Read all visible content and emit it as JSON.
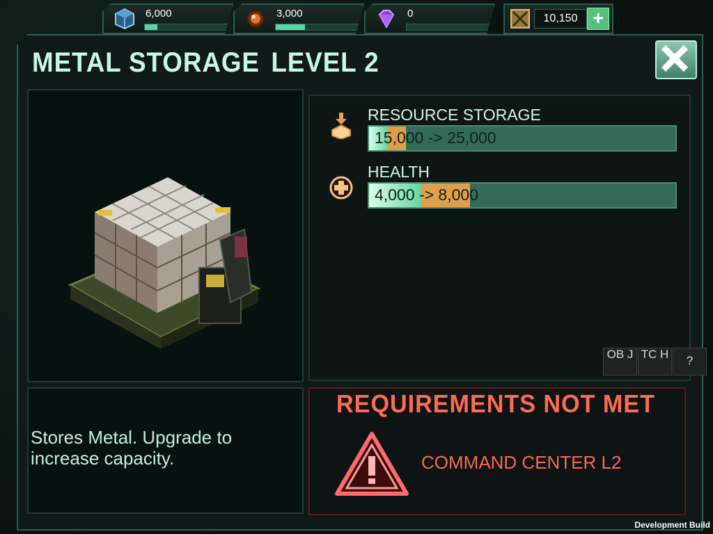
{
  "resources": {
    "metal": {
      "value": "6,000",
      "fill": 0.15
    },
    "oil": {
      "value": "3,000",
      "fill": 0.35
    },
    "gems": {
      "value": "0",
      "fill": 0.0
    },
    "gold": {
      "value": "10,150"
    }
  },
  "panel": {
    "title": "METAL STORAGE",
    "level": "LEVEL 2",
    "description": "Stores Metal. Upgrade to increase capacity."
  },
  "stats": [
    {
      "label": "RESOURCE STORAGE",
      "value": "15,000 -> 25,000",
      "current_fraction": 0.06,
      "upgrade_fraction": 0.12
    },
    {
      "label": "HEALTH",
      "value": "4,000 -> 8,000",
      "current_fraction": 0.17,
      "upgrade_fraction": 0.33
    }
  ],
  "tool_buttons": [
    "OB J",
    "TC H",
    "?"
  ],
  "requirements": {
    "title": "REQUIREMENTS NOT MET",
    "item": "COMMAND CENTER L2"
  },
  "footer": {
    "build": "Development Build"
  },
  "colors": {
    "accent": "#58d6a6",
    "warning": "#ff6a52",
    "bar_orange": "#e0a04b"
  }
}
